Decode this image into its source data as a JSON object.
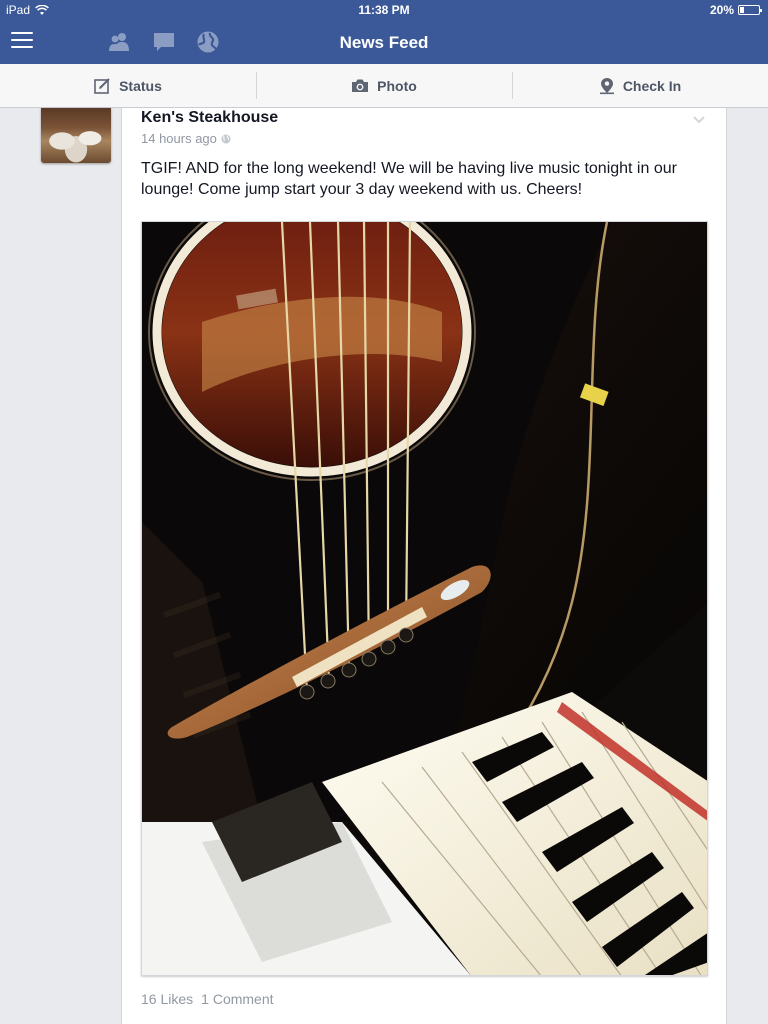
{
  "status_bar": {
    "device": "iPad",
    "time": "11:38 PM",
    "battery": "20%",
    "battery_level": 0.2
  },
  "nav": {
    "title": "News Feed",
    "icons": [
      "menu-icon",
      "friend-requests-icon",
      "messages-icon",
      "notifications-globe-icon"
    ]
  },
  "publisher": {
    "status_label": "Status",
    "photo_label": "Photo",
    "checkin_label": "Check In"
  },
  "post": {
    "author": "Ken's Steakhouse",
    "time": "14 hours ago",
    "privacy_icon": "globe-icon",
    "text": "TGIF! AND for the long weekend! We will be having live music tonight in our lounge! Come jump start your 3 day weekend with us. Cheers!",
    "photo_description_icon": "guitar-and-piano-photo",
    "likes": "16 Likes",
    "comments": "1 Comment"
  },
  "colors": {
    "brand": "#3b5998",
    "background": "#e9eaed",
    "muted_text": "#9197a3"
  }
}
